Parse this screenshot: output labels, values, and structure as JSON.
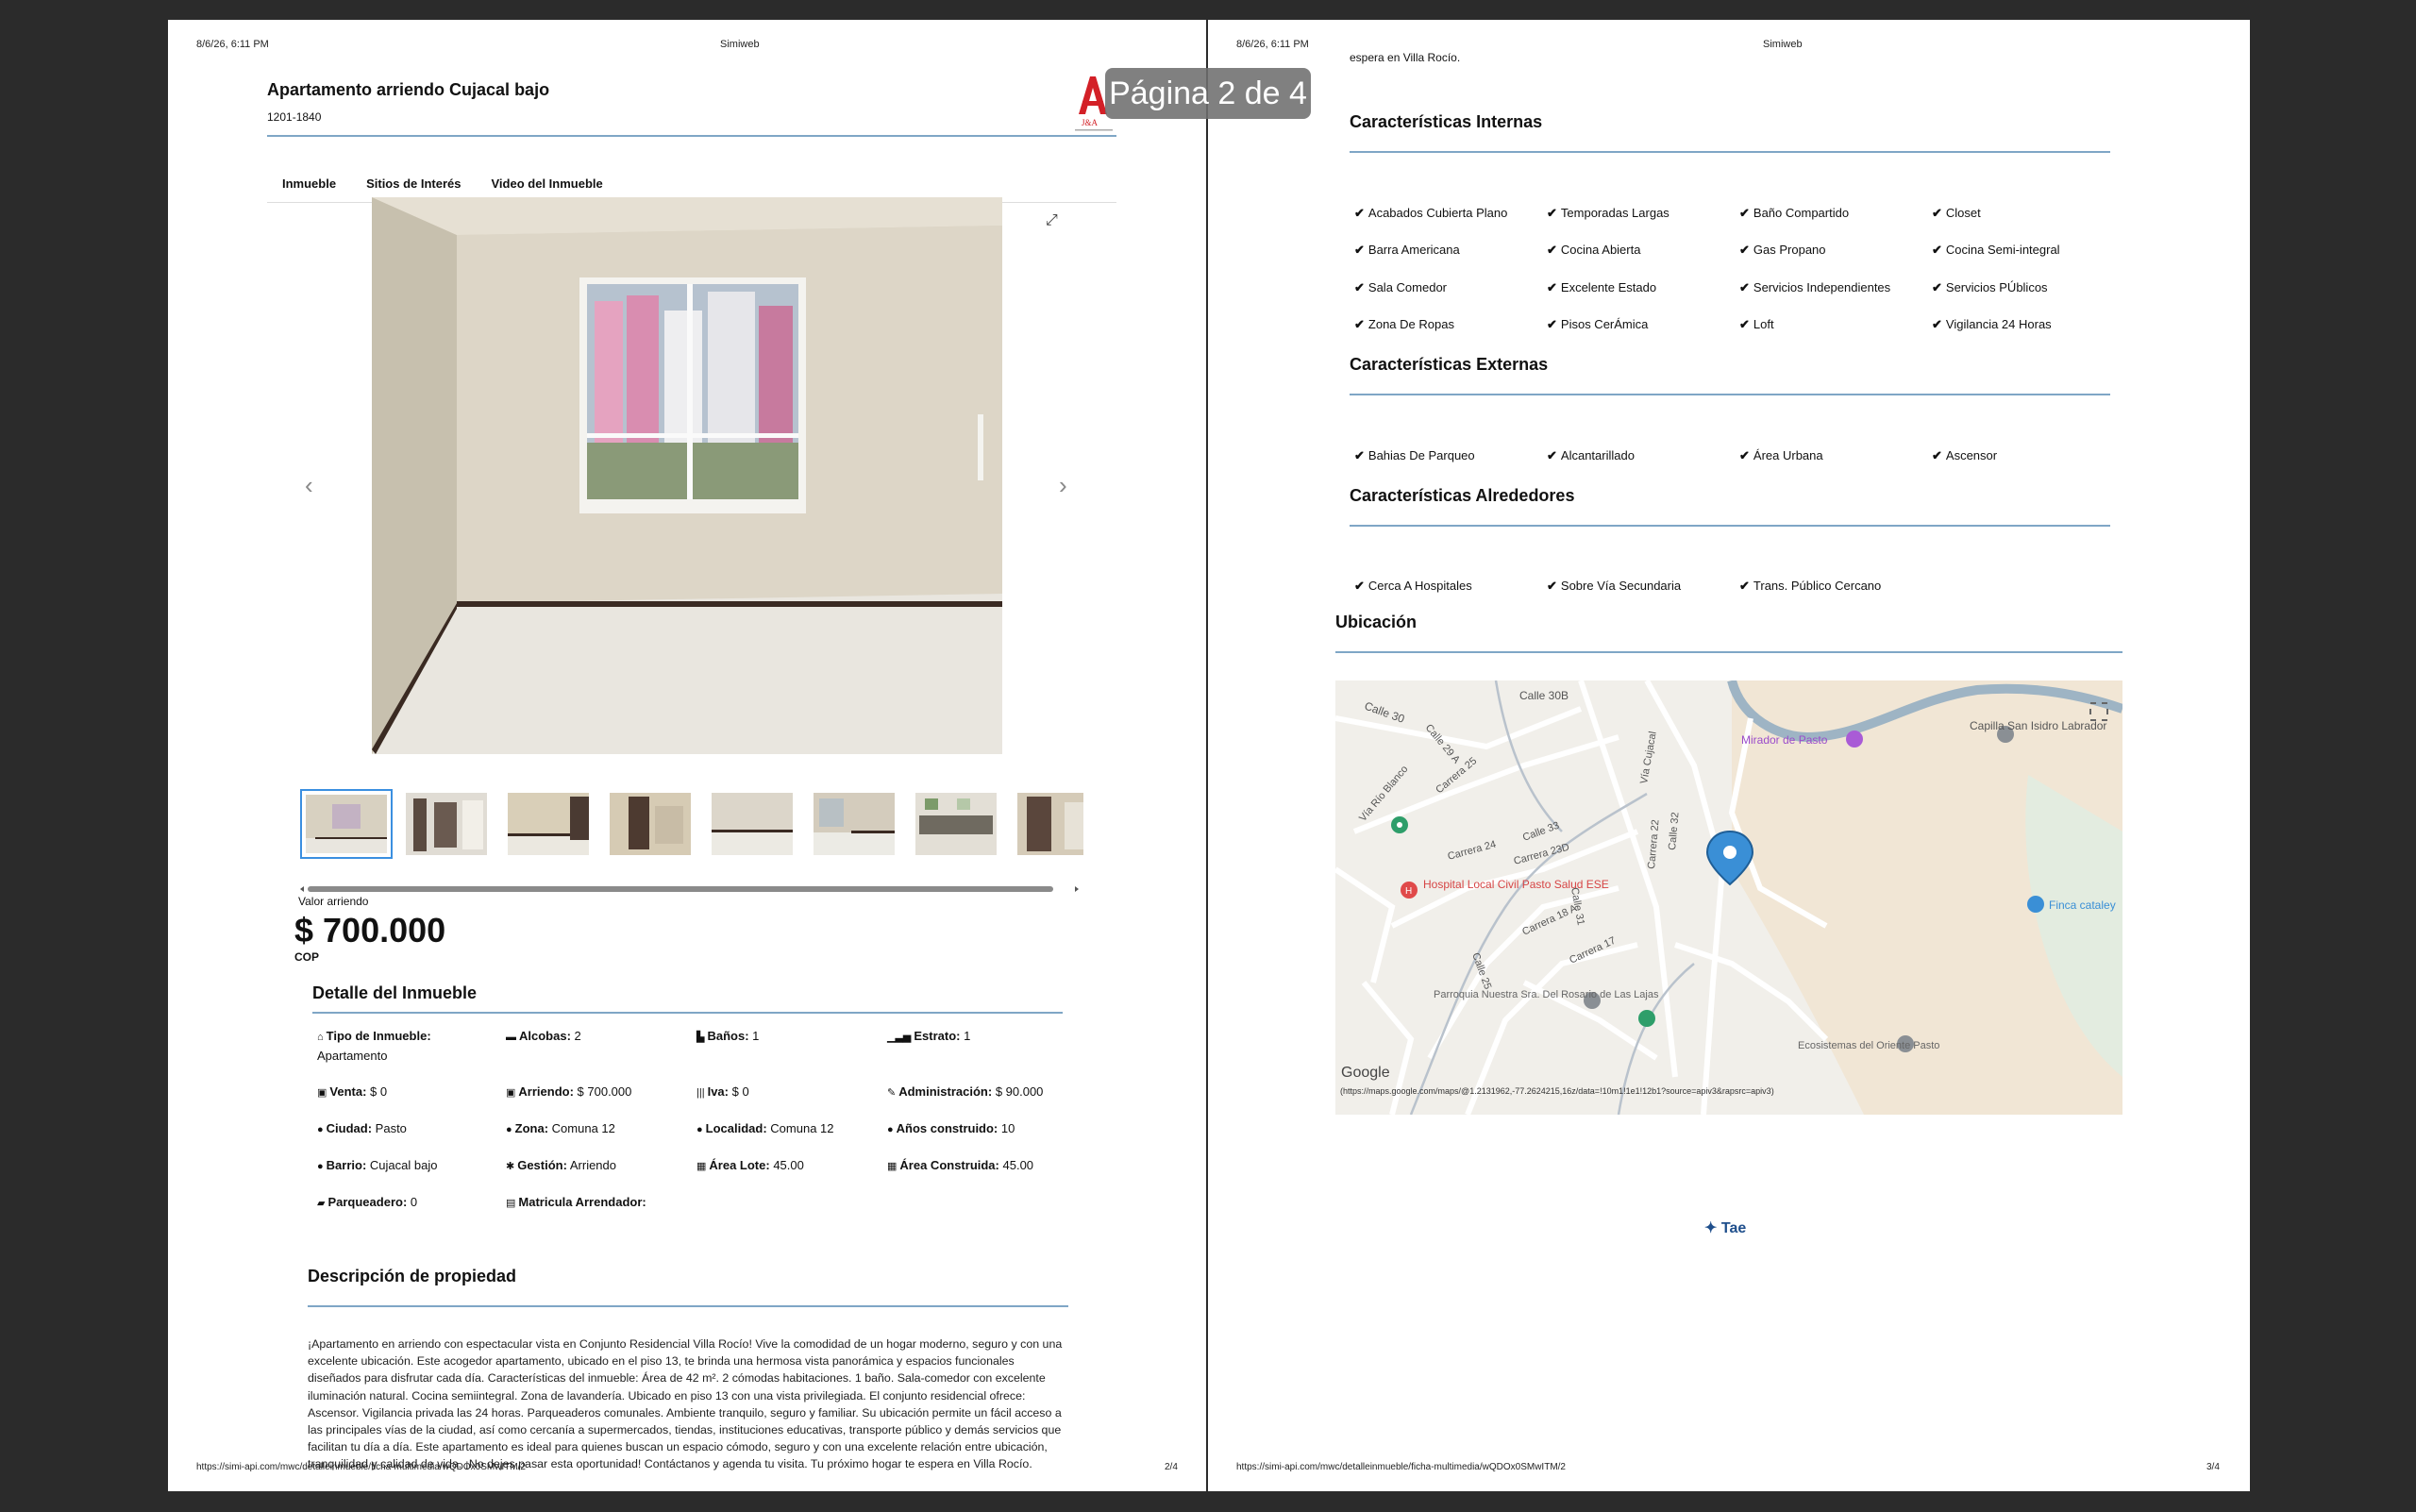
{
  "header": {
    "date": "8/6/26, 6:11 PM",
    "site": "Simiweb"
  },
  "left": {
    "title": "Apartamento arriendo Cujacal bajo",
    "code": "1201-1840",
    "tabs": [
      "Inmueble",
      "Sitios de Interés",
      "Video del Inmueble"
    ],
    "price_label": "Valor arriendo",
    "price": "$ 700.000",
    "currency": "COP",
    "detail_title": "Detalle del Inmueble",
    "details": [
      {
        "icon": "home-icon",
        "label": "Tipo de Inmueble:",
        "value": "Apartamento"
      },
      {
        "icon": "bed-icon",
        "label": "Alcobas:",
        "value": "2"
      },
      {
        "icon": "bath-icon",
        "label": "Baños:",
        "value": "1"
      },
      {
        "icon": "signal-icon",
        "label": "Estrato:",
        "value": "1"
      },
      {
        "icon": "money-icon",
        "label": "Venta:",
        "value": "$ 0"
      },
      {
        "icon": "money-icon",
        "label": "Arriendo:",
        "value": "$ 700.000"
      },
      {
        "icon": "barcode-icon",
        "label": "Iva:",
        "value": "$ 0"
      },
      {
        "icon": "wrench-icon",
        "label": "Administración:",
        "value": "$ 90.000"
      },
      {
        "icon": "map-marker-icon",
        "label": "Ciudad:",
        "value": "Pasto"
      },
      {
        "icon": "map-marker-icon",
        "label": "Zona:",
        "value": "Comuna 12"
      },
      {
        "icon": "map-marker-icon",
        "label": "Localidad:",
        "value": "Comuna 12"
      },
      {
        "icon": "map-marker-icon",
        "label": "Años construido:",
        "value": "10"
      },
      {
        "icon": "map-marker-icon",
        "label": "Barrio:",
        "value": "Cujacal bajo"
      },
      {
        "icon": "gears-icon",
        "label": "Gestión:",
        "value": "Arriendo"
      },
      {
        "icon": "grid-icon",
        "label": "Área Lote:",
        "value": "45.00"
      },
      {
        "icon": "grid-icon",
        "label": "Área Construida:",
        "value": "45.00"
      },
      {
        "icon": "car-icon",
        "label": "Parqueadero:",
        "value": "0"
      },
      {
        "icon": "id-card-icon",
        "label": "Matricula Arrendador:",
        "value": ""
      }
    ],
    "description_title": "Descripción de propiedad",
    "description": "¡Apartamento en arriendo con espectacular vista en Conjunto Residencial Villa Rocío! Vive la comodidad de un hogar moderno, seguro y con una excelente ubicación. Este acogedor apartamento, ubicado en el piso 13, te brinda una hermosa vista panorámica y espacios funcionales diseñados para disfrutar cada día. Características del inmueble: Área de 42 m². 2 cómodas habitaciones. 1 baño. Sala-comedor con excelente iluminación natural. Cocina semiintegral. Zona de lavandería. Ubicado en piso 13 con una vista privilegiada. El conjunto residencial ofrece: Ascensor. Vigilancia privada las 24 horas. Parqueaderos comunales. Ambiente tranquilo, seguro y familiar. Su ubicación permite un fácil acceso a las principales vías de la ciudad, así como cercanía a supermercados, tiendas, instituciones educativas, transporte público y demás servicios que facilitan tu día a día. Este apartamento es ideal para quienes buscan un espacio cómodo, seguro y con una excelente relación entre ubicación, tranquilidad y calidad de vida. ¡No dejes pasar esta oportunidad! Contáctanos y agenda tu visita. Tu próximo hogar te espera en Villa Rocío.",
    "footer_url": "https://simi-api.com/mwc/detalleinmueble/ficha-multimedia/wQDOx0SMwITM/2",
    "page_num": "2/4"
  },
  "right": {
    "cut_text": "espera en Villa Rocío.",
    "internal_title": "Características Internas",
    "internal": [
      "Acabados Cubierta Plano",
      "Temporadas Largas",
      "Baño Compartido",
      "Closet",
      "Barra Americana",
      "Cocina Abierta",
      "Gas Propano",
      "Cocina Semi-integral",
      "Sala Comedor",
      "Excelente Estado",
      "Servicios Independientes",
      "Servicios PÚblicos",
      "Zona De Ropas",
      "Pisos CerÁmica",
      "Loft",
      "Vigilancia 24 Horas"
    ],
    "external_title": "Características Externas",
    "external": [
      "Bahias De Parqueo",
      "Alcantarillado",
      "Área Urbana",
      "Ascensor"
    ],
    "surround_title": "Características Alrededores",
    "surround": [
      "Cerca A Hospitales",
      "Sobre Vía Secundaria",
      "Trans. Público Cercano"
    ],
    "location_title": "Ubicación",
    "map": {
      "labels": [
        "Mirador de Pasto",
        "Capilla San Isidro Labrador",
        "Hospital Local Civil Pasto Salud ESE",
        "Finca cataley",
        "Parroquia Nuestra Sra. Del Rosario de Las Lajas",
        "Ecosistemas del Oriente Pasto",
        "Google"
      ],
      "streets": [
        "Calle 30",
        "Calle 30B",
        "Calle 29 A",
        "Carrera 25",
        "Vía Río Blanco",
        "Carrera 24",
        "Calle 33",
        "Carrera 23D",
        "Vía Cujacal",
        "Carrera 18 A",
        "Carrera 17",
        "Calle 31",
        "Calle 32",
        "Carrera 22",
        "Calle 25"
      ],
      "url": "(https://maps.google.com/maps/@1.2131962,-77.2624215,16z/data=!10m1!1e1!12b1?source=apiv3&rapsrc=apiv3)"
    },
    "brand": "Tae",
    "footer_url": "https://simi-api.com/mwc/detalleinmueble/ficha-multimedia/wQDOx0SMwITM/2",
    "page_num": "3/4"
  },
  "page_badge": "Página 2 de 4",
  "colors": {
    "accent": "#7fa6c6",
    "thumb_active": "#3b8fe0",
    "logo_red": "#d32027"
  }
}
